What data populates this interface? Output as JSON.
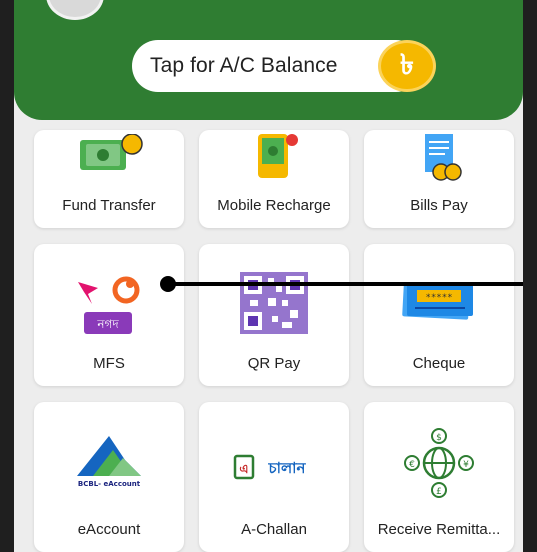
{
  "balance": {
    "label": "Tap for A/C Balance",
    "currency_icon": "taka-coin-icon"
  },
  "colors": {
    "header_green": "#2f7d32",
    "coin_gold": "#f5b800",
    "tile_bg": "#ffffff",
    "screen_bg": "#ededed"
  },
  "services": [
    {
      "label": "Fund Transfer",
      "icon": "money-transfer-icon"
    },
    {
      "label": "Mobile Recharge",
      "icon": "mobile-recharge-icon"
    },
    {
      "label": "Bills Pay",
      "icon": "bill-receipt-icon"
    },
    {
      "label": "MFS",
      "icon": "mfs-logos-icon",
      "badge": "নগদ"
    },
    {
      "label": "QR Pay",
      "icon": "qr-code-icon"
    },
    {
      "label": "Cheque",
      "icon": "cheque-icon"
    },
    {
      "label": "eAccount",
      "icon": "eaccount-logo-icon",
      "logo_text": "BCBL- eAccount"
    },
    {
      "label": "A-Challan",
      "icon": "a-challan-logo-icon",
      "logo_text": "চালান"
    },
    {
      "label": "Receive Remitta...",
      "icon": "remittance-globe-icon"
    }
  ]
}
